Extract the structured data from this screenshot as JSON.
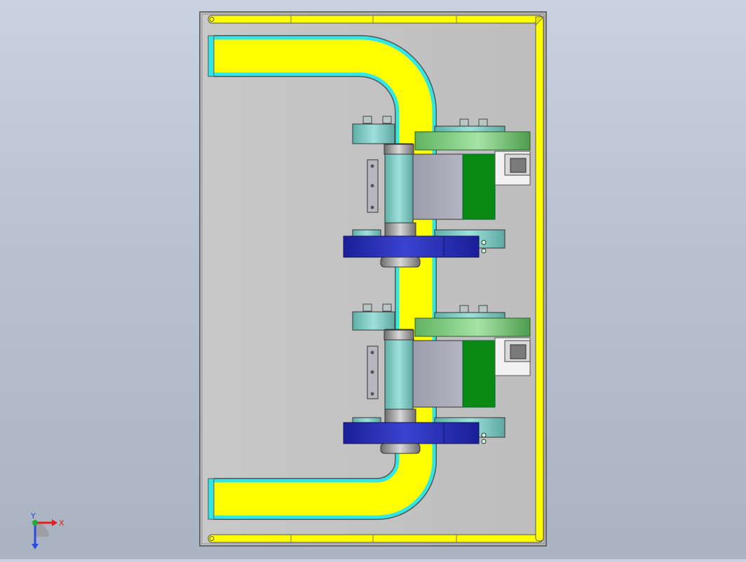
{
  "viewport": {
    "background_top": "#c9d2df",
    "background_bottom": "#a9b3c2"
  },
  "colors": {
    "plate": "#c4c4c4",
    "plate_edge": "#555555",
    "rail": "#ffff00",
    "conveyor": "#ffff00",
    "conveyor_border": "#33e6e6",
    "bracket_teal": "#7cc9c3",
    "gearbox_gray": "#a9a9b6",
    "motor_green": "#0a8a12",
    "belt_green": "#7dc97d",
    "pulley_blue": "#1f24a8",
    "hub_gray": "#8c8c8c",
    "motor_white": "#f2f2f2"
  },
  "triad": {
    "x_label": "X",
    "y_label": "Y",
    "x_color": "#e02020",
    "y_color": "#2a4be0"
  },
  "icons": [
    "coordinate-triad-icon"
  ]
}
